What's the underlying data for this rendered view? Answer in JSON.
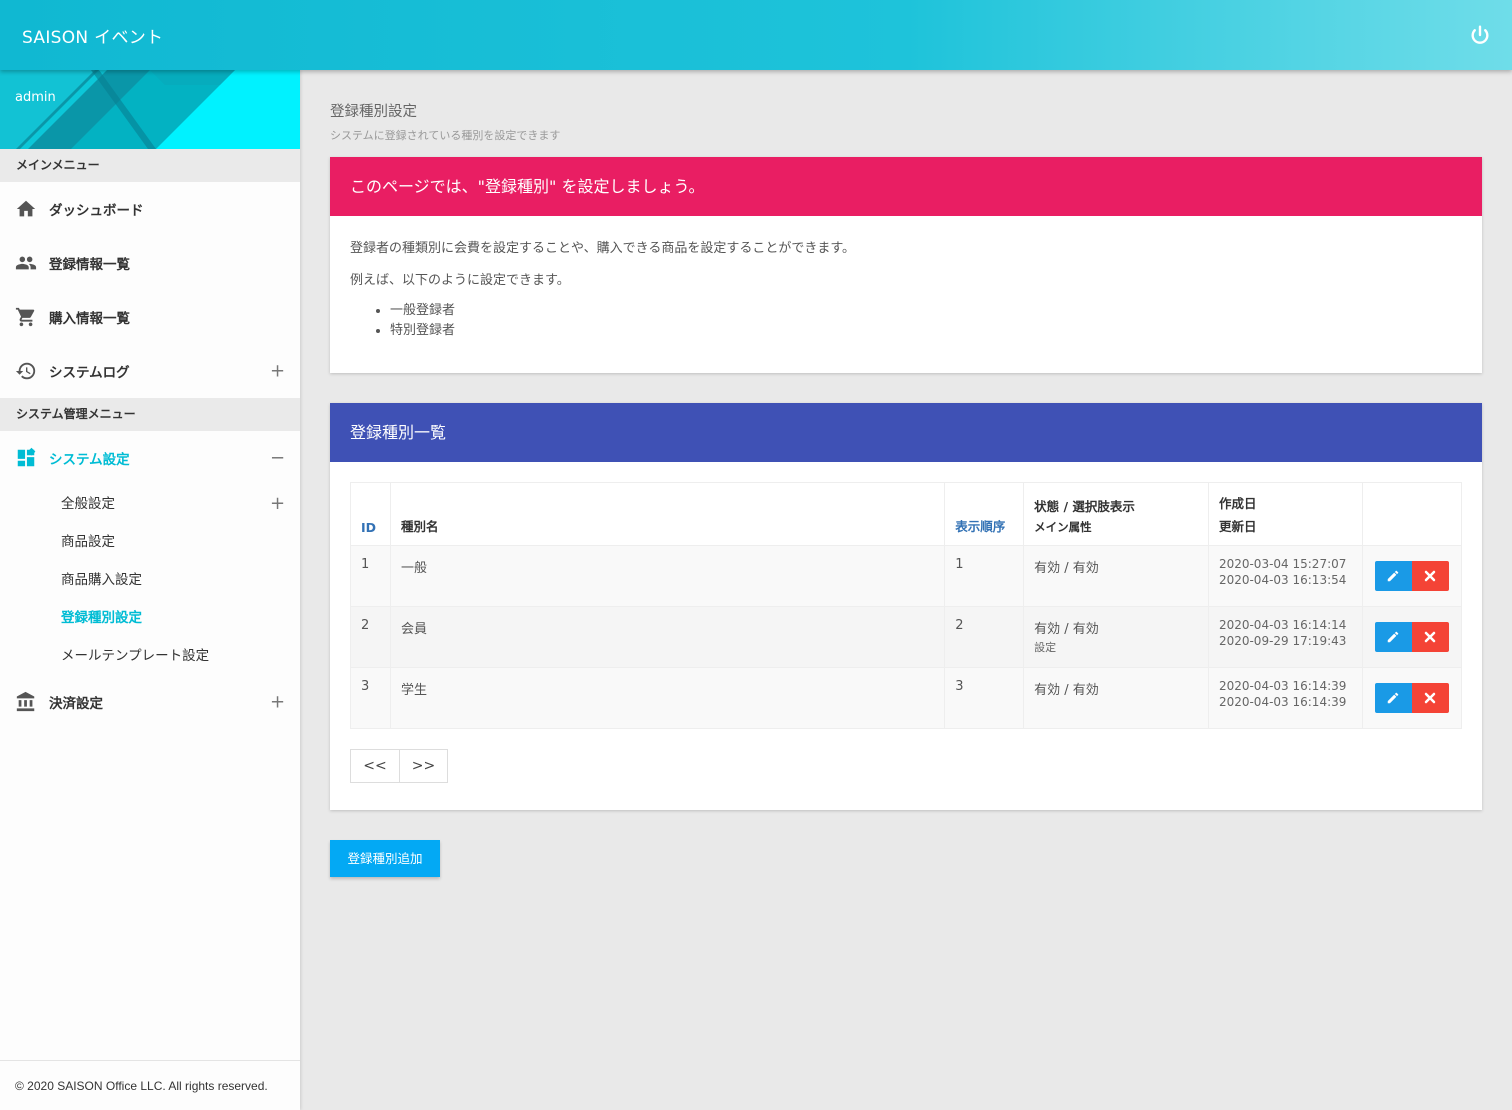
{
  "header": {
    "brand": "SAISON イベント",
    "power_icon": "power-icon"
  },
  "sidebar": {
    "user": "admin",
    "main_menu_title": "メインメニュー",
    "main_items": [
      {
        "label": "ダッシュボード",
        "icon": "home-icon"
      },
      {
        "label": "登録情報一覧",
        "icon": "people-icon"
      },
      {
        "label": "購入情報一覧",
        "icon": "cart-icon"
      },
      {
        "label": "システムログ",
        "icon": "history-icon",
        "toggle": "+"
      }
    ],
    "admin_menu_title": "システム管理メニュー",
    "system_settings": {
      "label": "システム設定",
      "icon": "dashboard-icon",
      "toggle": "−"
    },
    "sub_items": [
      {
        "label": "全般設定",
        "toggle": "+"
      },
      {
        "label": "商品設定"
      },
      {
        "label": "商品購入設定"
      },
      {
        "label": "登録種別設定"
      },
      {
        "label": "メールテンプレート設定"
      }
    ],
    "payment": {
      "label": "決済設定",
      "icon": "bank-icon",
      "toggle": "+"
    },
    "footer": "© 2020 SAISON Office LLC. All rights reserved.",
    "accent_color": "#00bcd4"
  },
  "page": {
    "title": "登録種別設定",
    "subtitle": "システムに登録されている種別を設定できます"
  },
  "info_card": {
    "heading": "このページでは、\"登録種別\" を設定しましょう。",
    "paragraph1": "登録者の種類別に会費を設定することや、購入できる商品を設定することができます。",
    "paragraph2": "例えば、以下のように設定できます。",
    "examples": [
      "一般登録者",
      "特別登録者"
    ],
    "color": "#e91e63"
  },
  "list_card": {
    "heading": "登録種別一覧",
    "color": "#3f51b5",
    "columns": {
      "id": "ID",
      "name": "種別名",
      "order": "表示順序",
      "status_line1": "状態 / 選択肢表示",
      "status_line2": "メイン属性",
      "created": "作成日",
      "updated": "更新日"
    },
    "rows": [
      {
        "id": "1",
        "name": "一般",
        "order": "1",
        "status": "有効 / 有効",
        "note": "",
        "created": "2020-03-04 15:27:07",
        "updated": "2020-04-03 16:13:54"
      },
      {
        "id": "2",
        "name": "会員",
        "order": "2",
        "status": "有効 / 有効",
        "note": "設定",
        "created": "2020-04-03 16:14:14",
        "updated": "2020-09-29 17:19:43"
      },
      {
        "id": "3",
        "name": "学生",
        "order": "3",
        "status": "有効 / 有効",
        "note": "",
        "created": "2020-04-03 16:14:39",
        "updated": "2020-04-03 16:14:39"
      }
    ],
    "pager": {
      "prev": "<<",
      "next": ">>"
    }
  },
  "add_button": "登録種別追加"
}
